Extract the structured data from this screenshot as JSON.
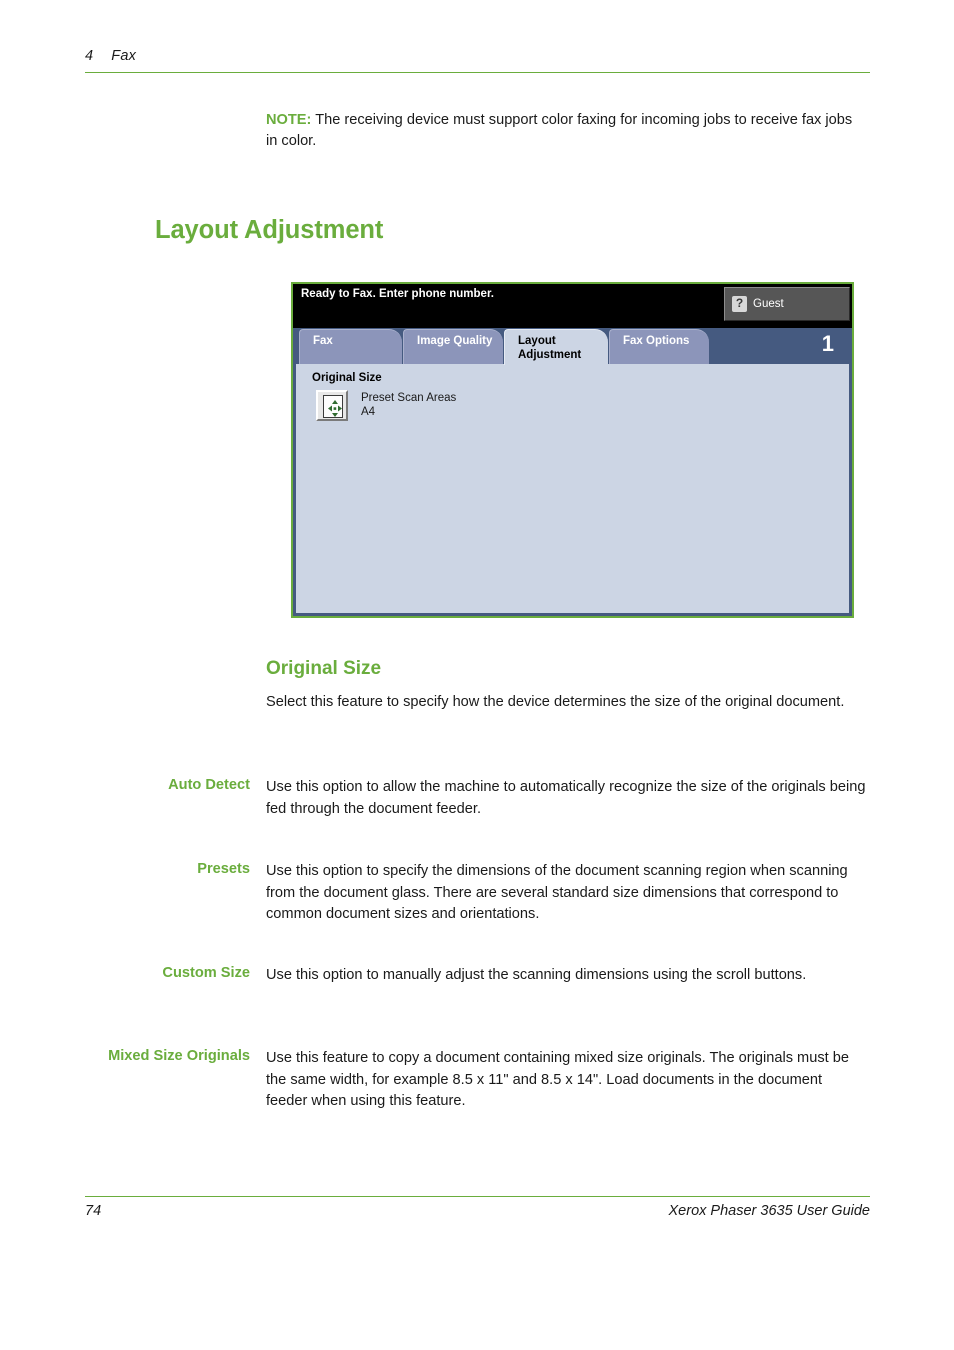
{
  "page": {
    "running_head_chapter": "4",
    "running_head_title": "Fax",
    "footer_page_number": "74",
    "footer_guide_title": "Xerox Phaser 3635 User Guide",
    "accent_green": "#6aad3d"
  },
  "note": {
    "label": "NOTE:",
    "text": " The receiving device must support color faxing for incoming jobs to receive fax jobs in color."
  },
  "heading": {
    "h1": "Layout Adjustment",
    "h2": "Original Size",
    "intro": "Select this feature to specify how the device determines the size of the original document."
  },
  "device_ui": {
    "status_message": "Ready to Fax. Enter phone number.",
    "guest_button_label": "Guest",
    "guest_icon": "question-key-icon",
    "page_count": "1",
    "tabs": [
      {
        "label": "Fax",
        "active": false
      },
      {
        "label": "Image Quality",
        "active": false
      },
      {
        "label": "Layout Adjustment",
        "active": true
      },
      {
        "label": "Fax Options",
        "active": false
      }
    ],
    "section_title": "Original Size",
    "option": {
      "icon": "preset-scan-area-icon",
      "line1": "Preset Scan Areas",
      "line2": "A4"
    },
    "colors": {
      "frame": "#6aad3d",
      "status_bar": "#000000",
      "tab_inactive": "#8c95ba",
      "tab_active": "#ccd5e4",
      "tab_bar": "#455a80",
      "panel_body": "#ccd5e4"
    }
  },
  "definitions": [
    {
      "term": "Auto Detect",
      "description": "Use this option to allow the machine to automatically recognize the size of the originals being fed through the document feeder."
    },
    {
      "term": "Presets",
      "description": "Use this option to specify the dimensions of the document scanning region when scanning from the document glass. There are several standard size dimensions that correspond to common document sizes and orientations."
    },
    {
      "term": "Custom Size",
      "description": "Use this option to manually adjust the scanning dimensions using the scroll buttons."
    },
    {
      "term": "Mixed Size Originals",
      "description": "Use this feature to copy a document containing mixed size originals. The originals must be the same width, for example 8.5 x 11\" and 8.5 x 14\". Load documents in the document feeder when using this feature."
    }
  ]
}
